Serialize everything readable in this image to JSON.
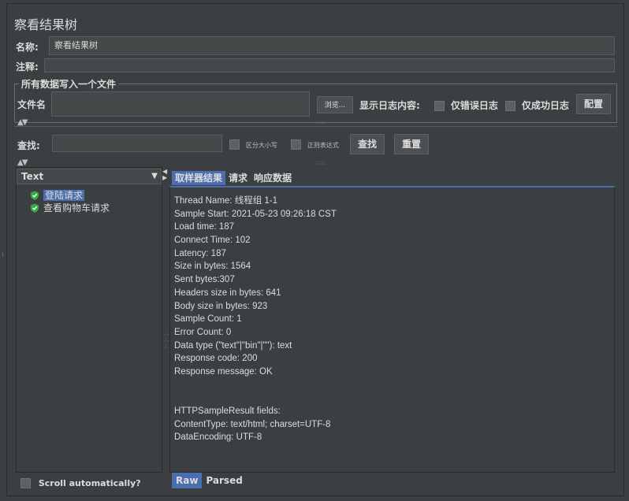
{
  "title": "察看结果树",
  "name_label": "名称:",
  "name_value": "察看结果树",
  "comment_label": "注释:",
  "comment_value": "",
  "file_group_title": "所有数据写入一个文件",
  "file_label": "文件名",
  "file_value": "",
  "browse_label": "浏览...",
  "log_label": "显示日志内容:",
  "errors_only_label": "仅错误日志",
  "success_only_label": "仅成功日志",
  "config_label": "配置",
  "search_label": "查找:",
  "search_value": "",
  "case_sensitive_label": "区分大小写",
  "regex_label": "正则表达式",
  "find_label": "查找",
  "reset_label": "重置",
  "renderer_selected": "Text",
  "tree_items": [
    "登陆请求",
    "查看购物车请求"
  ],
  "tree_status_color": "#2fae3b",
  "scroll_auto_label": "Scroll automatically?",
  "tabs": [
    "取样器结果",
    "请求",
    "响应数据"
  ],
  "result_lines": [
    "Thread Name: 线程组 1-1",
    "Sample Start: 2021-05-23 09:26:18 CST",
    "Load time: 187",
    "Connect Time: 102",
    "Latency: 187",
    "Size in bytes: 1564",
    "Sent bytes:307",
    "Headers size in bytes: 641",
    "Body size in bytes: 923",
    "Sample Count: 1",
    "Error Count: 0",
    "Data type (\"text\"|\"bin\"|\"\"): text",
    "Response code: 200",
    "Response message: OK",
    "",
    "",
    "HTTPSampleResult fields:",
    "ContentType: text/html; charset=UTF-8",
    "DataEncoding: UTF-8"
  ],
  "bottom_tabs": [
    "Raw",
    "Parsed"
  ],
  "accent_color": "#4b6eaf"
}
